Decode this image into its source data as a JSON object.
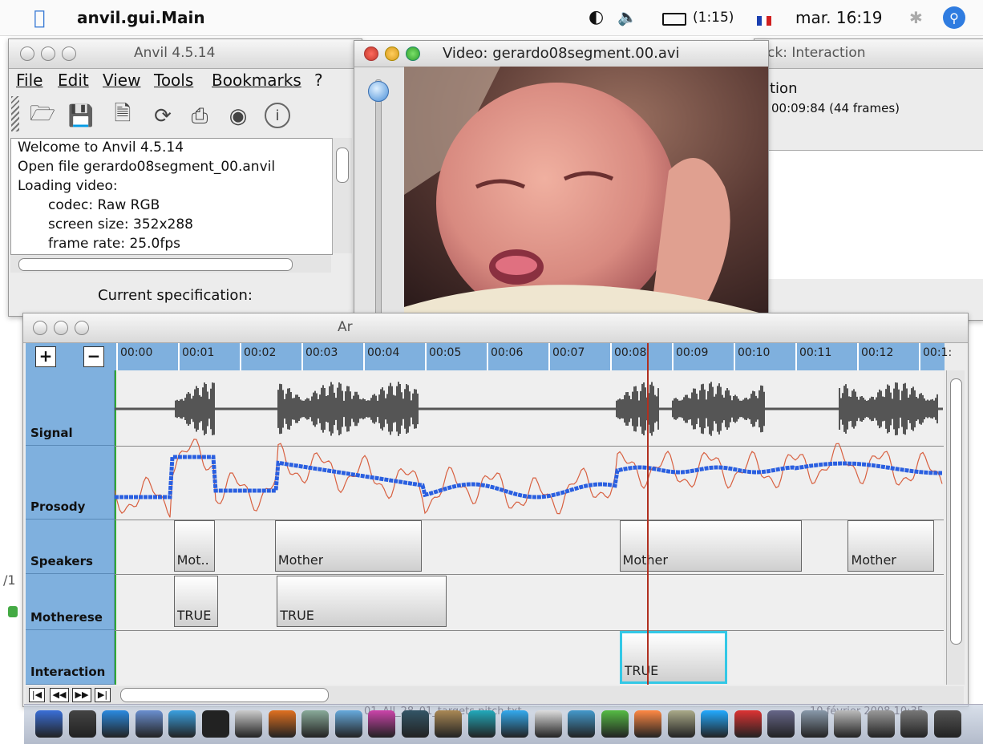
{
  "menubar": {
    "app_name": "anvil.gui.Main",
    "battery": "(1:15)",
    "clock": "mar. 16:19"
  },
  "anvil_window": {
    "title": "Anvil 4.5.14",
    "menu": [
      "File",
      "Edit",
      "View",
      "Tools",
      "Bookmarks",
      "?"
    ],
    "toolbar_icons": [
      "open-folder-icon",
      "save-icon",
      "new-document-icon",
      "refresh-icon",
      "print-icon",
      "binoculars-icon",
      "info-icon"
    ],
    "log": [
      "Welcome to Anvil 4.5.14",
      "Open file gerardo08segment_00.anvil",
      "Loading video:",
      "codec: Raw RGB",
      "screen size: 352x288",
      "frame rate: 25.0fps"
    ],
    "current_spec_label": "Current specification:"
  },
  "video_window": {
    "title": "Video: gerardo08segment.00.avi"
  },
  "track_window": {
    "title_fragment": "ck: Interaction",
    "info_fragment": "tion",
    "duration": "00:09:84 (44 frames)"
  },
  "annotation_window": {
    "title_fragment": "Ar",
    "zoom_in": "+",
    "zoom_out": "−",
    "ticks": [
      "00:00",
      "00:01",
      "00:02",
      "00:03",
      "00:04",
      "00:05",
      "00:06",
      "00:07",
      "00:08",
      "00:09",
      "00:10",
      "00:11",
      "00:12",
      "00:1:"
    ],
    "tracks": [
      "Signal",
      "Prosody",
      "Speakers",
      "Motherese",
      "Interaction"
    ],
    "speakers": [
      {
        "label": "Mot..",
        "start": 0.93,
        "end": 1.6
      },
      {
        "label": "Mother",
        "start": 2.57,
        "end": 4.95
      },
      {
        "label": "Mother",
        "start": 8.15,
        "end": 11.1
      },
      {
        "label": "Mother",
        "start": 11.85,
        "end": 13.25
      }
    ],
    "motherese": [
      {
        "label": "TRUE",
        "start": 0.93,
        "end": 1.65
      },
      {
        "label": "TRUE",
        "start": 2.6,
        "end": 5.35
      }
    ],
    "interaction": [
      {
        "label": "TRUE",
        "start": 8.15,
        "end": 9.9
      }
    ],
    "playhead": 8.6,
    "nav_buttons": [
      "first-icon",
      "rewind-icon",
      "forward-icon",
      "last-icon"
    ]
  },
  "background_texts": {
    "dock_fragment_1": "01_All_28_01_targets pitch.txt",
    "dock_fragment_2": "10 février 2008 10:35"
  },
  "colors": {
    "track_label_bg": "#7fb0de",
    "prosody_blue": "#2a5fe0",
    "prosody_red": "#d86040",
    "playhead": "#b03020",
    "selection": "#33c8e6"
  }
}
